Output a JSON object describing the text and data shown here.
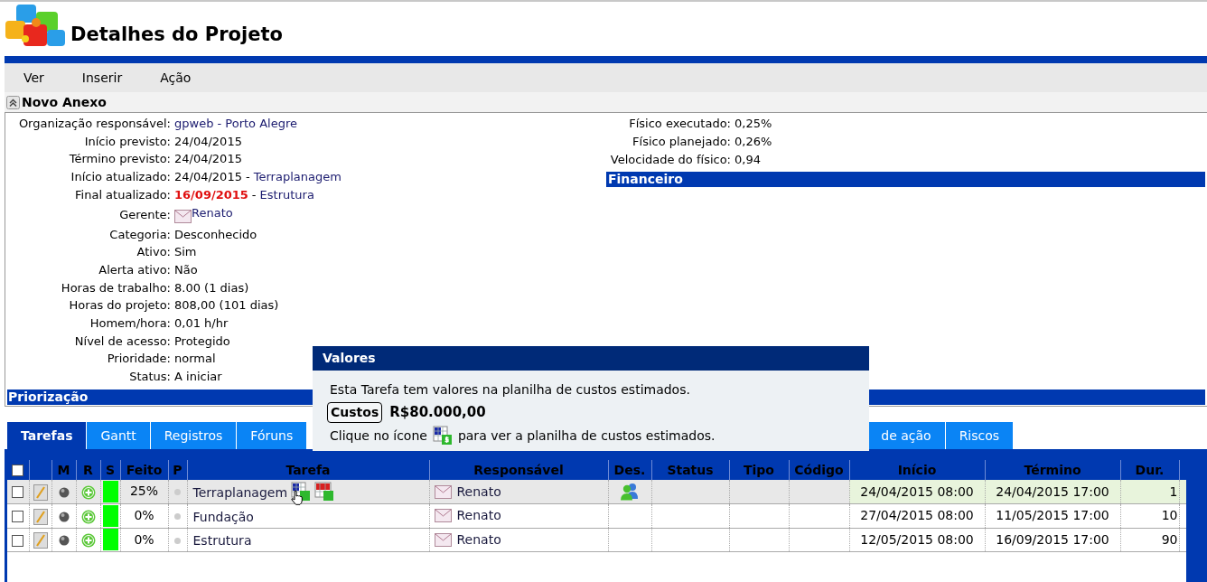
{
  "header": {
    "title": "Detalhes do Projeto"
  },
  "menu": [
    "Ver",
    "Inserir",
    "Ação"
  ],
  "section": {
    "title": "Novo Anexo"
  },
  "details_left": [
    {
      "label": "Organização responsável:",
      "parts": [
        {
          "kind": "link",
          "text": "gpweb - Porto Alegre"
        }
      ]
    },
    {
      "label": "Início previsto:",
      "parts": [
        {
          "kind": "text",
          "text": "24/04/2015"
        }
      ]
    },
    {
      "label": "Término previsto:",
      "parts": [
        {
          "kind": "text",
          "text": "24/04/2015"
        }
      ]
    },
    {
      "label": "Início atualizado:",
      "parts": [
        {
          "kind": "text",
          "text": "24/04/2015 -"
        },
        {
          "kind": "link",
          "text": "Terraplanagem"
        }
      ]
    },
    {
      "label": "Final atualizado:",
      "parts": [
        {
          "kind": "alert",
          "text": "16/09/2015"
        },
        {
          "kind": "text",
          "text": "-"
        },
        {
          "kind": "link",
          "text": "Estrutura"
        }
      ]
    },
    {
      "label": "Gerente:",
      "parts": [
        {
          "kind": "contact",
          "text": "Renato"
        }
      ]
    },
    {
      "label": "Categoria:",
      "parts": [
        {
          "kind": "text",
          "text": "Desconhecido"
        }
      ]
    },
    {
      "label": "Ativo:",
      "parts": [
        {
          "kind": "text",
          "text": "Sim"
        }
      ]
    },
    {
      "label": "Alerta ativo:",
      "parts": [
        {
          "kind": "text",
          "text": "Não"
        }
      ]
    },
    {
      "label": "Horas de trabalho:",
      "parts": [
        {
          "kind": "text",
          "text": "8.00 (1 dias)"
        }
      ]
    },
    {
      "label": "Horas do projeto:",
      "parts": [
        {
          "kind": "text",
          "text": "808,00 (101 dias)"
        }
      ]
    },
    {
      "label": "Homem/hora:",
      "parts": [
        {
          "kind": "text",
          "text": "0,01 h/hr"
        }
      ]
    },
    {
      "label": "Nível de acesso:",
      "parts": [
        {
          "kind": "text",
          "text": "Protegido"
        }
      ]
    },
    {
      "label": "Prioridade:",
      "parts": [
        {
          "kind": "text",
          "text": "normal"
        }
      ]
    },
    {
      "label": "Status:",
      "parts": [
        {
          "kind": "text",
          "text": "A iniciar"
        }
      ]
    }
  ],
  "details_right": [
    {
      "label": "Físico executado:",
      "value": "0,25%"
    },
    {
      "label": "Físico planejado:",
      "value": "0,26%"
    },
    {
      "label": "Velocidade do físico:",
      "value": "0,94"
    }
  ],
  "financeiro": {
    "title": "Financeiro"
  },
  "priorizacao": {
    "title": "Priorização"
  },
  "tabs": [
    {
      "label": "Tarefas",
      "selected": true
    },
    {
      "label": "Gantt",
      "selected": false
    },
    {
      "label": "Registros",
      "selected": false
    },
    {
      "label": "Fóruns",
      "selected": false
    },
    {
      "label": "de ação",
      "selected": false
    },
    {
      "label": "Riscos",
      "selected": false
    }
  ],
  "table": {
    "select_all": {
      "checked": false
    },
    "columns": [
      "M",
      "R",
      "S",
      "Feito",
      "P",
      "Tarefa",
      "Responsável",
      "Des.",
      "Status",
      "Tipo",
      "Código",
      "Início",
      "Término",
      "Dur."
    ],
    "rows": [
      {
        "selected": true,
        "checked": false,
        "color": "#00ff00",
        "done": "25%",
        "task": "Terraplanagem",
        "has_costs": true,
        "responsible": "Renato",
        "has_designees": true,
        "start": "24/04/2015 08:00",
        "end": "24/04/2015 17:00",
        "duration": "1"
      },
      {
        "selected": false,
        "checked": false,
        "color": "#00ff00",
        "done": "0%",
        "task": "Fundação",
        "has_costs": false,
        "responsible": "Renato",
        "has_designees": false,
        "start": "27/04/2015 08:00",
        "end": "11/05/2015 17:00",
        "duration": "10"
      },
      {
        "selected": false,
        "checked": false,
        "color": "#00ff00",
        "done": "0%",
        "task": "Estrutura",
        "has_costs": false,
        "responsible": "Renato",
        "has_designees": false,
        "start": "12/05/2015 08:00",
        "end": "16/09/2015 17:00",
        "duration": "90"
      }
    ]
  },
  "tooltip": {
    "title": "Valores",
    "message": "Esta Tarefa tem valores na planilha de custos estimados.",
    "cost_label": "Custos",
    "cost_value": "R$80.000,00",
    "hint_before": "Clique no ícone",
    "hint_after": "para ver a planilha de custos estimados."
  }
}
